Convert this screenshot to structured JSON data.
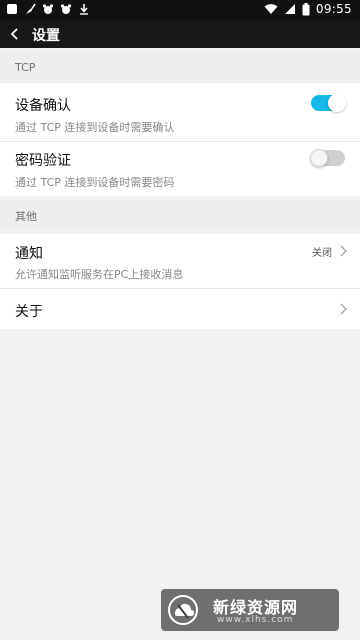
{
  "status_bar": {
    "time": "09:55",
    "icons_left": [
      "app-icon",
      "broom-icon",
      "bear-icon",
      "bear-icon",
      "download-icon"
    ],
    "icons_right": [
      "wifi-icon",
      "signal-icon",
      "battery-icon"
    ]
  },
  "app_bar": {
    "title": "设置"
  },
  "sections": {
    "tcp": {
      "header": "TCP"
    },
    "other": {
      "header": "其他"
    }
  },
  "settings": {
    "device_confirm": {
      "label": "设备确认",
      "desc": "通过 TCP 连接到设备时需要确认",
      "enabled": true
    },
    "password_verify": {
      "label": "密码验证",
      "desc": "通过 TCP 连接到设备时需要密码",
      "enabled": false
    },
    "notification": {
      "label": "通知",
      "desc": "允许通知监听服务在PC上接收消息",
      "value": "关闭"
    },
    "about": {
      "label": "关于"
    }
  },
  "watermark": {
    "title": "新绿资源网",
    "url": "www.xlhs.com"
  },
  "colors": {
    "accent": "#16b7e6",
    "appbar": "#171717",
    "background": "#f2f2f2"
  }
}
